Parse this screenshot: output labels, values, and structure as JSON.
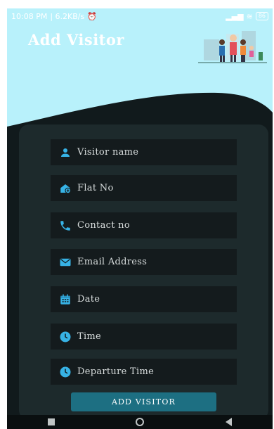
{
  "status_bar": {
    "time": "10:08 PM",
    "speed": "| 6.2KB/s",
    "battery": "86"
  },
  "header": {
    "title": "Add Visitor",
    "illustration_icon": "family-illustration"
  },
  "form": {
    "fields": [
      {
        "placeholder": "Visitor name",
        "icon": "person-icon"
      },
      {
        "placeholder": "Flat No",
        "icon": "house-icon"
      },
      {
        "placeholder": "Contact no",
        "icon": "phone-icon"
      },
      {
        "placeholder": "Email Address",
        "icon": "email-icon"
      },
      {
        "placeholder": "Date",
        "icon": "calendar-icon"
      },
      {
        "placeholder": "Time",
        "icon": "clock-icon"
      },
      {
        "placeholder": "Departure Time",
        "icon": "clock-icon"
      }
    ],
    "submit_label": "ADD VISITOR"
  },
  "colors": {
    "header_bg": "#b8f1fb",
    "card_bg": "#1d2a2c",
    "field_bg": "#141b1d",
    "accent": "#37b3e6",
    "button": "#1d6f82"
  }
}
